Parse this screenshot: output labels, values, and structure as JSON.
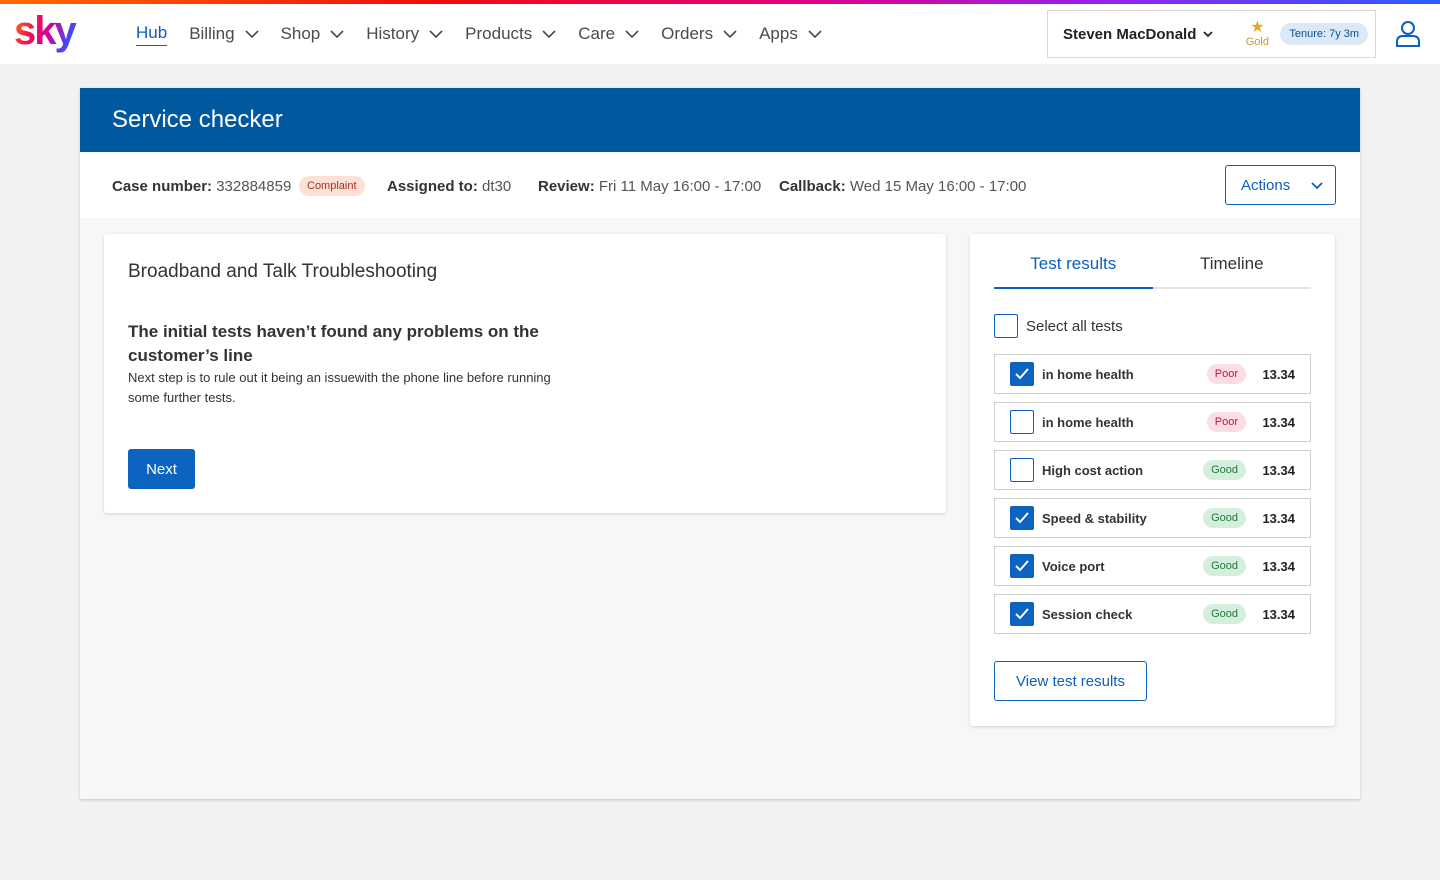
{
  "brand": {
    "logo_text": "sky"
  },
  "nav": {
    "items": [
      {
        "label": "Hub",
        "active": true
      },
      {
        "label": "Billing"
      },
      {
        "label": "Shop"
      },
      {
        "label": "History"
      },
      {
        "label": "Products"
      },
      {
        "label": "Care"
      },
      {
        "label": "Orders"
      },
      {
        "label": "Apps"
      }
    ]
  },
  "user": {
    "name": "Steven MacDonald",
    "tier": "Gold",
    "tenure": "Tenure: 7y 3m"
  },
  "page": {
    "title": "Service checker",
    "case_label": "Case number:",
    "case_number": "332884859",
    "case_badge": "Complaint",
    "assigned_label": "Assigned to:",
    "assigned_value": "dt30",
    "review_label": "Review:",
    "review_value": "Fri 11 May 16:00 - 17:00",
    "callback_label": "Callback:",
    "callback_value": "Wed 15 May 16:00 - 17:00",
    "actions_label": "Actions"
  },
  "troubleshooting": {
    "title": "Broadband and Talk Troubleshooting",
    "heading": "The initial tests haven’t found any problems on the customer’s line",
    "body": "Next step is to rule out it being an issuewith the phone line before running some further tests.",
    "next_label": "Next"
  },
  "results": {
    "tabs": [
      {
        "label": "Test results",
        "active": true
      },
      {
        "label": "Timeline"
      }
    ],
    "select_all_label": "Select all tests",
    "tests": [
      {
        "name": "in home health",
        "status": "Poor",
        "value": "13.34",
        "checked": true
      },
      {
        "name": "in home health",
        "status": "Poor",
        "value": "13.34",
        "checked": false
      },
      {
        "name": "High cost action",
        "status": "Good",
        "value": "13.34",
        "checked": false
      },
      {
        "name": "Speed & stability",
        "status": "Good",
        "value": "13.34",
        "checked": true
      },
      {
        "name": "Voice port",
        "status": "Good",
        "value": "13.34",
        "checked": true
      },
      {
        "name": "Session check",
        "status": "Good",
        "value": "13.34",
        "checked": true
      }
    ],
    "view_label": "View test results"
  },
  "colors": {
    "brand_blue": "#00599f",
    "accent_blue": "#0b5fbf",
    "poor": "#c0153b",
    "good": "#1e7a3a"
  },
  "icons": [
    "sky-logo",
    "chevron-down-icon",
    "star-icon",
    "user-profile-icon",
    "check-icon"
  ]
}
